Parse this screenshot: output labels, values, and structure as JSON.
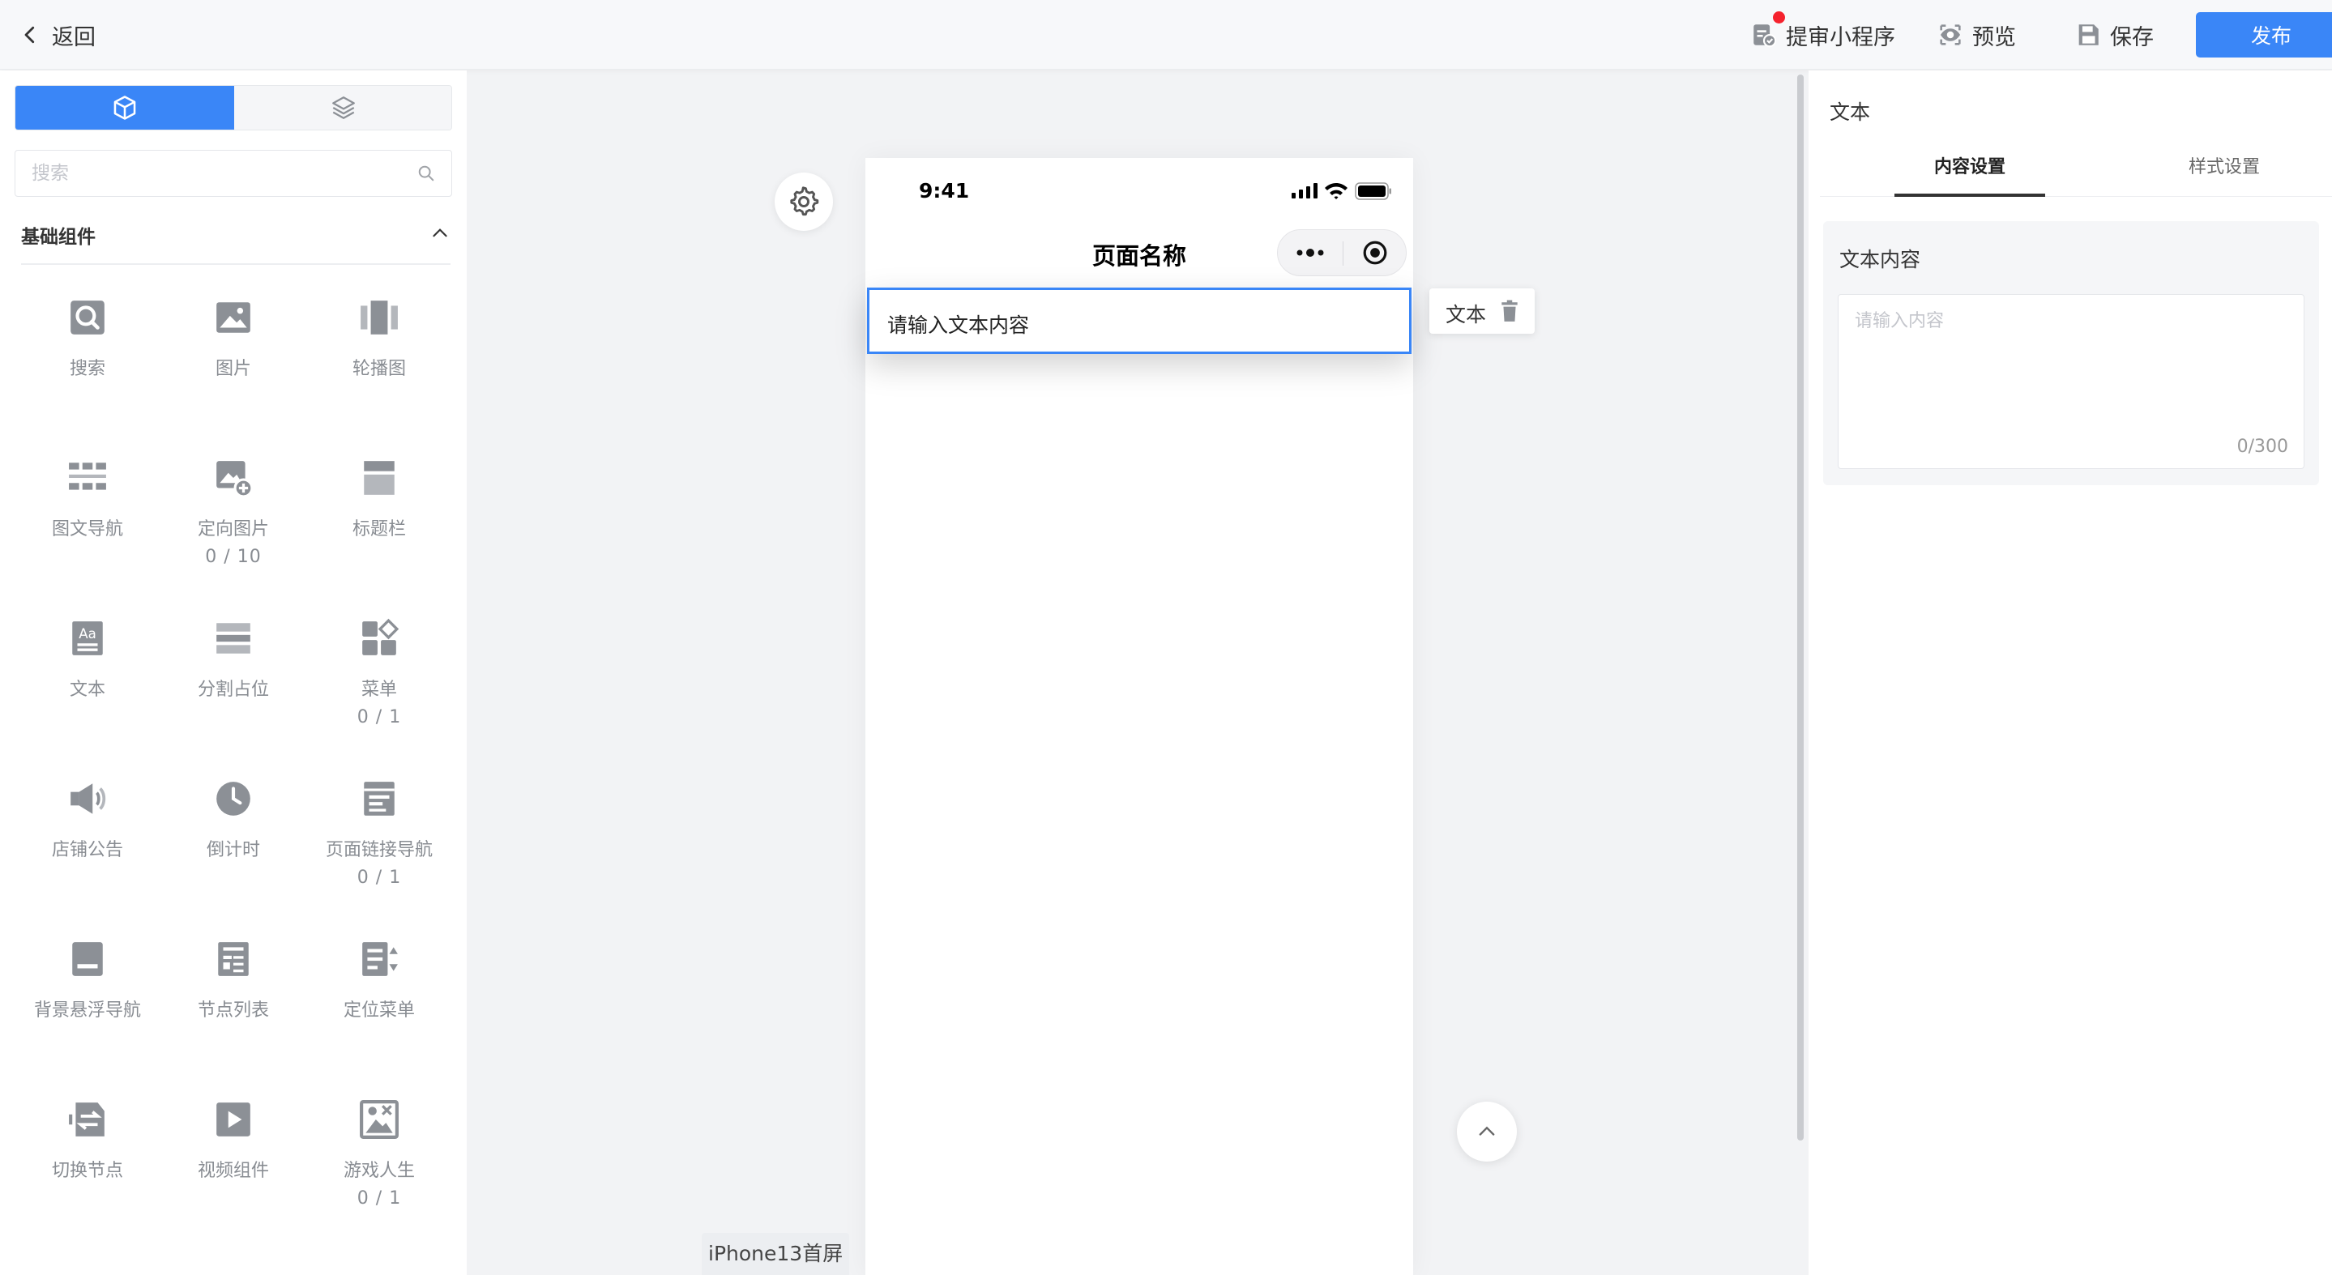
{
  "topbar": {
    "back_label": "返回",
    "actions": {
      "review_label": "提审小程序",
      "preview_label": "预览",
      "save_label": "保存",
      "publish_label": "发布"
    }
  },
  "left_panel": {
    "search_placeholder": "搜索",
    "section_title": "基础组件",
    "components": [
      {
        "label": "搜索",
        "count": "",
        "icon": "search-icon"
      },
      {
        "label": "图片",
        "count": "",
        "icon": "image-icon"
      },
      {
        "label": "轮播图",
        "count": "",
        "icon": "carousel-icon"
      },
      {
        "label": "图文导航",
        "count": "",
        "icon": "grid-nav-icon"
      },
      {
        "label": "定向图片",
        "count": "0 / 10",
        "icon": "image-add-icon"
      },
      {
        "label": "标题栏",
        "count": "",
        "icon": "title-bar-icon"
      },
      {
        "label": "文本",
        "count": "",
        "icon": "text-icon"
      },
      {
        "label": "分割占位",
        "count": "",
        "icon": "divider-icon"
      },
      {
        "label": "菜单",
        "count": "0 / 1",
        "icon": "menu-icon"
      },
      {
        "label": "店铺公告",
        "count": "",
        "icon": "speaker-icon"
      },
      {
        "label": "倒计时",
        "count": "",
        "icon": "clock-icon"
      },
      {
        "label": "页面链接导航",
        "count": "0 / 1",
        "icon": "page-link-icon"
      },
      {
        "label": "背景悬浮导航",
        "count": "",
        "icon": "float-nav-icon"
      },
      {
        "label": "节点列表",
        "count": "",
        "icon": "node-list-icon"
      },
      {
        "label": "定位菜单",
        "count": "",
        "icon": "locate-menu-icon"
      },
      {
        "label": "切换节点",
        "count": "",
        "icon": "switch-node-icon"
      },
      {
        "label": "视频组件",
        "count": "",
        "icon": "video-icon"
      },
      {
        "label": "游戏人生",
        "count": "0 / 1",
        "icon": "game-image-icon"
      }
    ]
  },
  "phone": {
    "time": "9:41",
    "page_title": "页面名称",
    "text_content": "请输入文本内容",
    "screen_label": "iPhone13首屏"
  },
  "component_tag": {
    "label": "文本"
  },
  "right_panel": {
    "title": "文本",
    "tabs": [
      "内容设置",
      "样式设置"
    ],
    "field_label": "文本内容",
    "textarea_placeholder": "请输入内容",
    "counter": "0/300"
  },
  "colors": {
    "accent": "#3a86f7",
    "icon_gray": "#8c9096",
    "dot_red": "#f5222d"
  }
}
